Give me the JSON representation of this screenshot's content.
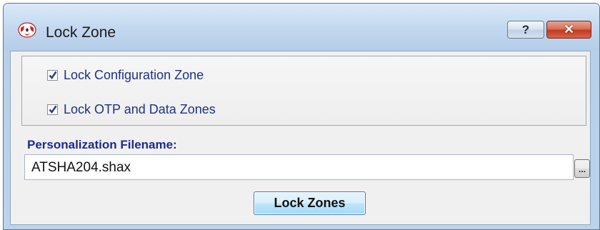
{
  "window": {
    "title": "Lock Zone",
    "help_label": "?",
    "close_label": "✕",
    "app_icon": "lock-zone-app-icon"
  },
  "options": {
    "lock_config": {
      "label": "Lock Configuration Zone",
      "checked": true
    },
    "lock_otp_data": {
      "label": "Lock OTP and Data Zones",
      "checked": true
    }
  },
  "personalization": {
    "label": "Personalization Filename:",
    "value": "ATSHA204.shax",
    "browse_label": "..."
  },
  "actions": {
    "lock_label": "Lock Zones"
  },
  "colors": {
    "label_blue": "#1e2a94",
    "checkbox_text": "#1e3287",
    "close_red": "#c3391f"
  }
}
